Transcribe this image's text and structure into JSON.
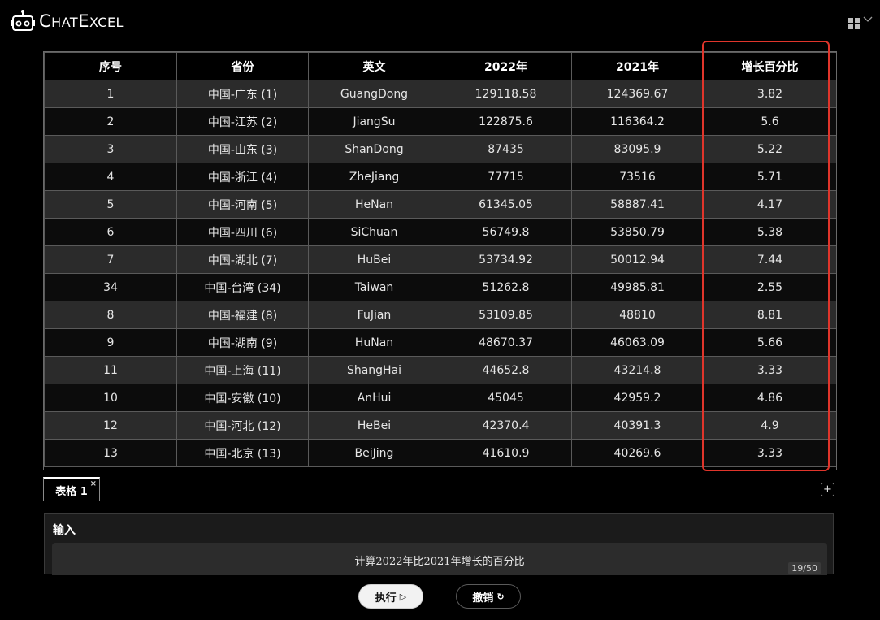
{
  "app": {
    "title_first": "C",
    "title_rest_1": "HAT",
    "title_mid": "E",
    "title_rest_2": "XCEL"
  },
  "table": {
    "headers": [
      "序号",
      "省份",
      "英文",
      "2022年",
      "2021年",
      "增长百分比"
    ],
    "rows": [
      [
        "1",
        "中国-广东 (1)",
        "GuangDong",
        "129118.58",
        "124369.67",
        "3.82"
      ],
      [
        "2",
        "中国-江苏 (2)",
        "JiangSu",
        "122875.6",
        "116364.2",
        "5.6"
      ],
      [
        "3",
        "中国-山东 (3)",
        "ShanDong",
        "87435",
        "83095.9",
        "5.22"
      ],
      [
        "4",
        "中国-浙江 (4)",
        "ZheJiang",
        "77715",
        "73516",
        "5.71"
      ],
      [
        "5",
        "中国-河南 (5)",
        "HeNan",
        "61345.05",
        "58887.41",
        "4.17"
      ],
      [
        "6",
        "中国-四川 (6)",
        "SiChuan",
        "56749.8",
        "53850.79",
        "5.38"
      ],
      [
        "7",
        "中国-湖北 (7)",
        "HuBei",
        "53734.92",
        "50012.94",
        "7.44"
      ],
      [
        "34",
        "中国-台湾 (34)",
        "Taiwan",
        "51262.8",
        "49985.81",
        "2.55"
      ],
      [
        "8",
        "中国-福建 (8)",
        "FuJian",
        "53109.85",
        "48810",
        "8.81"
      ],
      [
        "9",
        "中国-湖南 (9)",
        "HuNan",
        "48670.37",
        "46063.09",
        "5.66"
      ],
      [
        "11",
        "中国-上海 (11)",
        "ShangHai",
        "44652.8",
        "43214.8",
        "3.33"
      ],
      [
        "10",
        "中国-安徽 (10)",
        "AnHui",
        "45045",
        "42959.2",
        "4.86"
      ],
      [
        "12",
        "中国-河北 (12)",
        "HeBei",
        "42370.4",
        "40391.3",
        "4.9"
      ],
      [
        "13",
        "中国-北京 (13)",
        "BeiJing",
        "41610.9",
        "40269.6",
        "3.33"
      ]
    ],
    "highlight_color": "#e0352b"
  },
  "tabs": {
    "sheet_label": "表格 1",
    "close_glyph": "×",
    "add_glyph": "+"
  },
  "input": {
    "label": "输入",
    "value": "计算2022年比2021年增长的百分比",
    "char_count": "19/50"
  },
  "buttons": {
    "run_label": "执行",
    "run_icon": "▷",
    "undo_label": "撤销",
    "undo_icon": "↻"
  },
  "icons": {
    "logo": "robot-icon",
    "menu": "grid-menu-icon",
    "menu_caret": "chevron-down-icon"
  }
}
